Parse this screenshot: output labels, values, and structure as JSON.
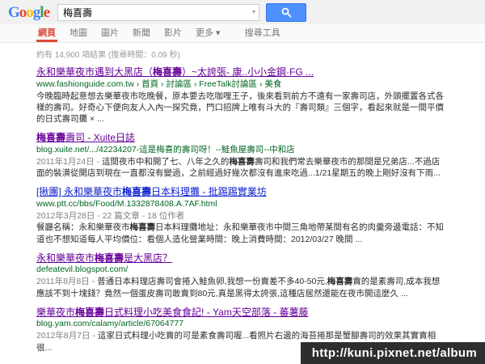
{
  "header": {
    "logo_letters": [
      {
        "ch": "G",
        "color": "#4285f4"
      },
      {
        "ch": "o",
        "color": "#ea4335"
      },
      {
        "ch": "o",
        "color": "#fbbc05"
      },
      {
        "ch": "g",
        "color": "#4285f4"
      },
      {
        "ch": "l",
        "color": "#34a853"
      },
      {
        "ch": "e",
        "color": "#ea4335"
      }
    ],
    "search": {
      "query": "梅喜壽"
    }
  },
  "tabs": {
    "items": [
      {
        "name": "web",
        "label": "網頁",
        "active": true
      },
      {
        "name": "maps",
        "label": "地圖",
        "active": false
      },
      {
        "name": "images",
        "label": "圖片",
        "active": false
      },
      {
        "name": "news",
        "label": "新聞",
        "active": false
      },
      {
        "name": "videos",
        "label": "影片",
        "active": false
      },
      {
        "name": "more",
        "label": "更多",
        "arrow": true,
        "active": false
      }
    ],
    "tools_label": "搜尋工具"
  },
  "stats": "約有 14,900 項結果 (搜尋時間：0.09 秒)",
  "results": [
    {
      "visited": true,
      "title": [
        {
          "t": "永和樂華夜市遇到大黑店（"
        },
        {
          "t": "梅喜壽",
          "b": true
        },
        {
          "t": "）~太誇張- 康..小小金鋼·FG ..."
        }
      ],
      "url": "www.fashionguide.com.tw › 首頁 › 討論區 › FreeTalk討論區 › 美食",
      "snippet": [
        {
          "t": "今晚臨時起意想去樂華夜市吃晚餐，原本要去吃咖哩王子，後來看到前方不遠有一家壽司店，外頭擺置各式各樣的壽司。好奇心下便向友人入內一探究竟，門口招牌上唯有斗大的『壽司類』三個字，看起來就是一間平價的日式壽司攤 × ..."
        }
      ]
    },
    {
      "visited": true,
      "title": [
        {
          "t": "梅喜壽",
          "b": true
        },
        {
          "t": "壽司 - Xuite日誌"
        }
      ],
      "url": "blog.xuite.net/.../42234207-這是梅喜的壽司呀！--鮭魚屋壽司--中和店",
      "snippet": [
        {
          "t": "2011年1月24日 - ",
          "gray": true
        },
        {
          "t": "這間夜市中和開了七、八年之久的"
        },
        {
          "t": "梅喜壽",
          "b": true
        },
        {
          "t": "壽司和我們常去樂華夜市的那間是兄弟店...不過店面的裝潢從開店到現在一直都沒有變過，之前經過好幾次都沒有進來吃過...1/21星期五的晚上剛好沒有下雨..."
        }
      ]
    },
    {
      "visited": false,
      "title": [
        {
          "t": "[揪團] 永和樂華夜市"
        },
        {
          "t": "梅喜壽",
          "b": true
        },
        {
          "t": "日本料理攤 - 批踢踢實業坊"
        }
      ],
      "url": "www.ptt.cc/bbs/Food/M.1332878408.A.7AF.html",
      "meta": "2012年3月28日 - 22 篇文章 - 18 位作者",
      "snippet": [
        {
          "t": "餐廳名稱：永和樂華夜市"
        },
        {
          "t": "梅喜壽",
          "b": true
        },
        {
          "t": "日本料理攤地址：永和樂華夜市中間三角地帶某間有名的肉羹旁邊電話：不知道也不想知道每人平均價位：看個人造化營業時間：晚上消費時間：2012/03/27 晚間 ..."
        }
      ]
    },
    {
      "visited": true,
      "title": [
        {
          "t": "永和樂華夜市"
        },
        {
          "t": "梅喜壽",
          "b": true
        },
        {
          "t": "是大黑店？"
        }
      ],
      "url": "defeatevil.blogspot.com/",
      "snippet": [
        {
          "t": "2011年8月8日 - ",
          "gray": true
        },
        {
          "t": "普通日本料理店壽司會捲入鮭魚卵,我想一份賣差不多40-50元,"
        },
        {
          "t": "梅喜壽",
          "b": true
        },
        {
          "t": "賣的是素壽司,成本我想應該不到十塊錢？竟然一個蛋皮壽司敢賣到80元,真是黑得太誇張,這種店居然還能在夜市開這麼久 ..."
        }
      ]
    },
    {
      "visited": true,
      "title": [
        {
          "t": "樂華夜市"
        },
        {
          "t": "梅喜壽",
          "b": true
        },
        {
          "t": "日式料理小吃美食食記! - Yam天空部落 - 蕃薯藤"
        }
      ],
      "url": "blog.yam.com/calamy/article/67064777",
      "snippet": [
        {
          "t": "2012年8月7日 - ",
          "gray": true
        },
        {
          "t": "這家日式料理小吃賣的可是素食壽司喔...看照片右邊的海苔捲那是蟹腳壽司的效果其實賣相很..."
        }
      ]
    }
  ],
  "watermark": "http://kuni.pixnet.net/album",
  "colors": {
    "link": "#1122cc",
    "visited_link": "#660099",
    "url_green": "#006621",
    "active_tab_red": "#dd4b39",
    "button_blue": "#4d90fe"
  }
}
